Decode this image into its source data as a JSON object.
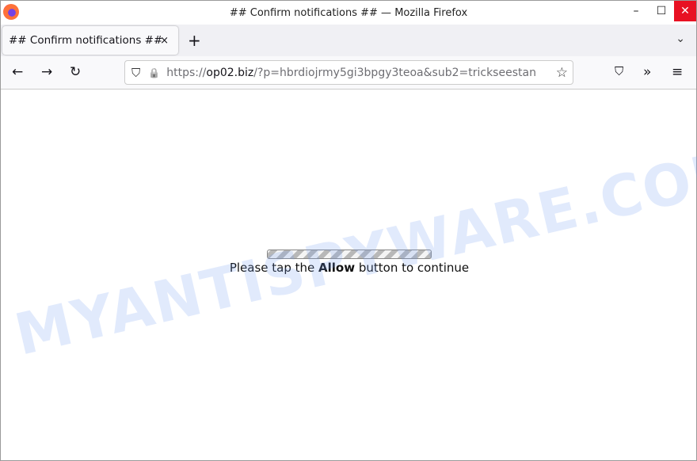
{
  "window": {
    "title": "## Confirm notifications ## — Mozilla Firefox",
    "minimize": "–",
    "maximize": "☐",
    "close": "✕"
  },
  "tab": {
    "title": "## Confirm notifications ##",
    "close": "×",
    "new_tab": "+",
    "list_all": "⌄"
  },
  "nav": {
    "back": "←",
    "forward": "→",
    "reload": "↻",
    "url_scheme": "https://",
    "url_host": "op02.biz",
    "url_rest": "/?p=hbrdiojrmy5gi3bpgy3teoa&sub2=trickseestan",
    "shield": "⛉",
    "lock": "🔒",
    "bookmark": "☆",
    "pocket": "⛉",
    "overflow": "»",
    "menu": "≡"
  },
  "page": {
    "message_pre": "Please tap the ",
    "message_bold": "Allow",
    "message_post": " button to continue",
    "progress": "indeterminate"
  },
  "watermark": "MYANTISPYWARE.COM"
}
